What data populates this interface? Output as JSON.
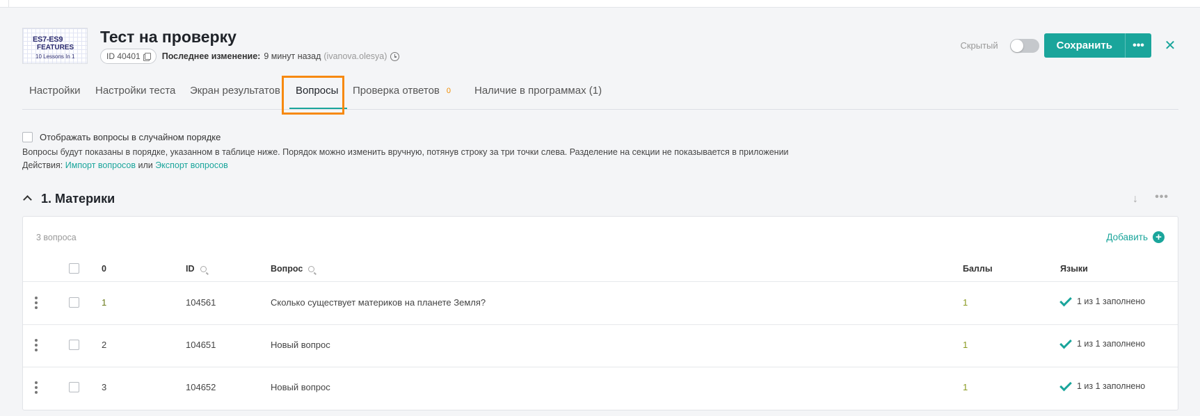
{
  "header": {
    "thumbnail": {
      "line1": "ES7-ES9",
      "line2": "FEATURES",
      "line3": "10 Lessons In 1"
    },
    "title": "Тест на проверку",
    "id_badge": "ID 40401",
    "last_change_label": "Последнее изменение:",
    "last_change_value": "9 минут назад",
    "last_change_user": "(ivanova.olesya)",
    "hidden_label": "Скрытый",
    "hidden_toggle": false,
    "save_label": "Сохранить",
    "more_label": "•••",
    "close_label": "✕"
  },
  "tabs": [
    {
      "label": "Настройки"
    },
    {
      "label": "Настройки теста"
    },
    {
      "label": "Экран результатов"
    },
    {
      "label": "Вопросы",
      "active": true
    },
    {
      "label": "Проверка ответов",
      "count": "0"
    },
    {
      "label": "Наличие в программах (1)"
    }
  ],
  "options": {
    "random_order_label": "Отображать вопросы в случайном порядке",
    "info": "Вопросы будут показаны в порядке, указанном в таблице ниже. Порядок можно изменить вручную, потянув строку за три точки слева. Разделение на секции не показывается в приложении",
    "actions_prefix": "Действия:",
    "import_link": "Импорт вопросов",
    "actions_or": "или",
    "export_link": "Экспорт вопросов"
  },
  "section": {
    "title": "1. Материки",
    "arrow": "↓",
    "more": "•••"
  },
  "table": {
    "count_label": "3 вопроса",
    "add_label": "Добавить",
    "add_icon": "+",
    "headers": {
      "order": "0",
      "id": "ID",
      "question": "Вопрос",
      "score": "Баллы",
      "languages": "Языки"
    },
    "rows": [
      {
        "order": "1",
        "id": "104561",
        "question": "Сколько существует материков на планете Земля?",
        "score": "1",
        "languages": "1 из 1 заполнено"
      },
      {
        "order": "2",
        "id": "104651",
        "question": "Новый вопрос",
        "score": "1",
        "languages": "1 из 1 заполнено"
      },
      {
        "order": "3",
        "id": "104652",
        "question": "Новый вопрос",
        "score": "1",
        "languages": "1 из 1 заполнено"
      }
    ]
  },
  "colors": {
    "accent": "#1aa59b",
    "highlight": "#f7890f",
    "count": "#f08c00"
  }
}
